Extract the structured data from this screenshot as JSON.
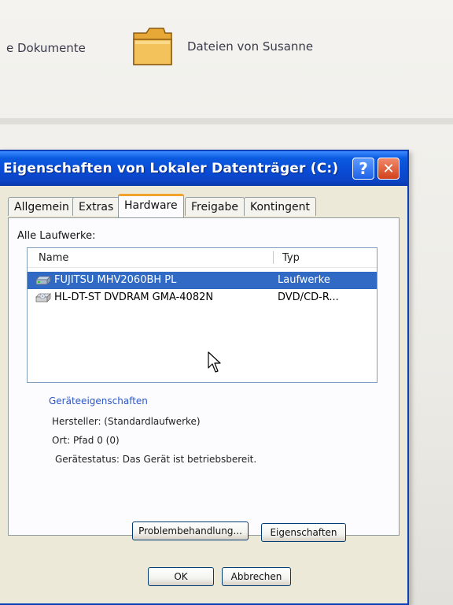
{
  "explorer": {
    "item_1_label": "e Dokumente",
    "item_2_label": "Dateien von Susanne"
  },
  "dialog": {
    "title": "Eigenschaften von Lokaler Datenträger (C:)",
    "help_label": "?",
    "close_label": "✕"
  },
  "tabs": [
    {
      "label": "Allgemein"
    },
    {
      "label": "Extras"
    },
    {
      "label": "Hardware"
    },
    {
      "label": "Freigabe"
    },
    {
      "label": "Kontingent"
    }
  ],
  "active_tab": "Hardware",
  "hardware": {
    "all_drives_label": "Alle Laufwerke:",
    "columns": {
      "name": "Name",
      "typ": "Typ"
    },
    "rows": [
      {
        "name": "FUJITSU MHV2060BH PL",
        "typ": "Laufwerke",
        "selected": true,
        "icon": "hard-drive-icon"
      },
      {
        "name": "HL-DT-ST DVDRAM GMA-4082N",
        "typ": "DVD/CD-R...",
        "selected": false,
        "icon": "dvd-drive-icon"
      }
    ],
    "group_title": "Geräteeigenschaften",
    "hersteller": "Hersteller: (Standardlaufwerke)",
    "ort": "Ort: Pfad 0 (0)",
    "status": "Gerätestatus: Das Gerät ist betriebsbereit.",
    "troubleshoot_label": "Problembehandlung...",
    "properties_label": "Eigenschaften"
  },
  "footer": {
    "ok_label": "OK",
    "cancel_label": "Abbrechen"
  },
  "colors": {
    "titlebar": "#0a4bd6",
    "selection": "#316ac5",
    "active_tab_accent": "#f0a22c",
    "group_title": "#2a56c6"
  }
}
